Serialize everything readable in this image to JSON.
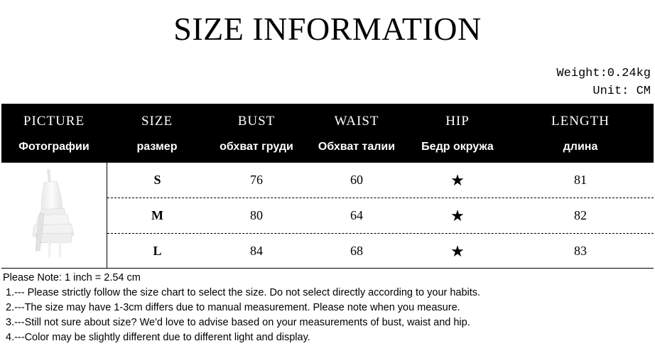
{
  "title": "SIZE INFORMATION",
  "weight": "Weight:0.24kg",
  "unit": "Unit: CM",
  "headers": [
    {
      "en": "PICTURE",
      "ru": "Фотографии"
    },
    {
      "en": "SIZE",
      "ru": "размер"
    },
    {
      "en": "BUST",
      "ru": "обхват груди"
    },
    {
      "en": "WAIST",
      "ru": "Обхват талии"
    },
    {
      "en": "HIP",
      "ru": "Бедр окружа"
    },
    {
      "en": "LENGTH",
      "ru": "длина"
    }
  ],
  "rows": [
    {
      "size": "S",
      "bust": "76",
      "waist": "60",
      "hip": "★",
      "length": "81"
    },
    {
      "size": "M",
      "bust": "80",
      "waist": "64",
      "hip": "★",
      "length": "82"
    },
    {
      "size": "L",
      "bust": "84",
      "waist": "68",
      "hip": "★",
      "length": "83"
    }
  ],
  "notes": {
    "intro": "Please Note: 1 inch = 2.54 cm",
    "items": [
      "1.--- Please strictly follow the size chart to select the size. Do not select directly according to your habits.",
      "2.---The size may have 1-3cm differs due to manual measurement. Please note when you measure.",
      "3.---Still not sure about size? We'd love to advise based on your measurements of bust, waist and hip.",
      "4.---Color may be slightly different due to different light and display."
    ]
  }
}
